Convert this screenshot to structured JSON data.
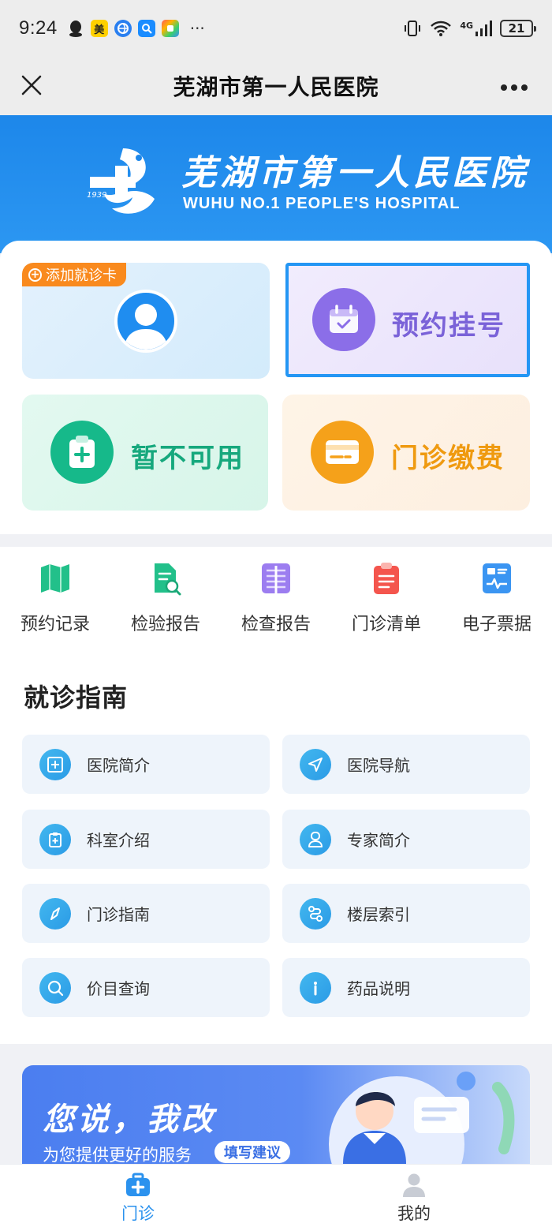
{
  "status_bar": {
    "time": "9:24",
    "apps": [
      "qq-icon",
      "meituan-icon",
      "browser-icon",
      "search-app-icon",
      "store-app-icon"
    ],
    "meituan_label": "美",
    "more": "···",
    "network": "4G",
    "battery": "21"
  },
  "nav": {
    "title": "芜湖市第一人民医院",
    "close_icon": "close-icon",
    "more_icon": "more-icon"
  },
  "header": {
    "logo_year": "1939",
    "name_cn": "芜湖市第一人民医院",
    "name_en": "WUHU NO.1 PEOPLE'S HOSPITAL"
  },
  "tiles": {
    "add_card_label": "添加就诊卡",
    "appointment_label": "预约挂号",
    "unavailable_label": "暂不可用",
    "payment_label": "门诊缴费"
  },
  "quick_links": [
    {
      "label": "预约记录",
      "icon": "map-icon"
    },
    {
      "label": "检验报告",
      "icon": "report-search-icon"
    },
    {
      "label": "检查报告",
      "icon": "scan-report-icon"
    },
    {
      "label": "门诊清单",
      "icon": "clipboard-list-icon"
    },
    {
      "label": "电子票据",
      "icon": "e-receipt-icon"
    }
  ],
  "guide": {
    "title": "就诊指南",
    "items": [
      {
        "label": "医院简介",
        "icon": "hospital-icon"
      },
      {
        "label": "医院导航",
        "icon": "navigation-icon"
      },
      {
        "label": "科室介绍",
        "icon": "clipboard-plus-icon"
      },
      {
        "label": "专家简介",
        "icon": "doctor-icon"
      },
      {
        "label": "门诊指南",
        "icon": "compass-icon"
      },
      {
        "label": "楼层索引",
        "icon": "route-icon"
      },
      {
        "label": "价目查询",
        "icon": "search-icon"
      },
      {
        "label": "药品说明",
        "icon": "info-icon"
      }
    ]
  },
  "feedback": {
    "title": "您说，我改",
    "subtitle": "为您提供更好的服务",
    "button": "填写建议"
  },
  "tabbar": {
    "items": [
      {
        "label": "门诊",
        "icon": "medical-kit-icon",
        "active": true
      },
      {
        "label": "我的",
        "icon": "person-icon",
        "active": false
      }
    ],
    "active_color": "#2b92ee",
    "inactive_color": "#333333"
  },
  "colors": {
    "brand_blue": "#1d87ea",
    "appointment_purple": "#8b6ee8",
    "green": "#16b98a",
    "orange": "#f5a11a"
  }
}
